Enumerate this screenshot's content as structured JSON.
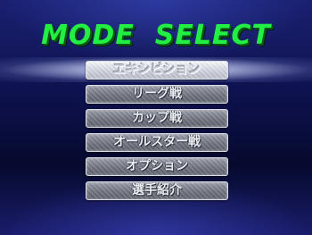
{
  "screen": {
    "title": "MODE  SELECT",
    "selected_index": 0
  },
  "menu": {
    "items": [
      {
        "label": "エキシビション"
      },
      {
        "label": "リーグ戦"
      },
      {
        "label": "カップ戦"
      },
      {
        "label": "オールスター戦"
      },
      {
        "label": "オプション"
      },
      {
        "label": "選手紹介"
      }
    ]
  },
  "colors": {
    "title": "#22ee44",
    "background_top": "#1a2070",
    "background_mid": "#060a2e",
    "button_face": "#70747f",
    "button_selected": "#f4f6fb"
  }
}
